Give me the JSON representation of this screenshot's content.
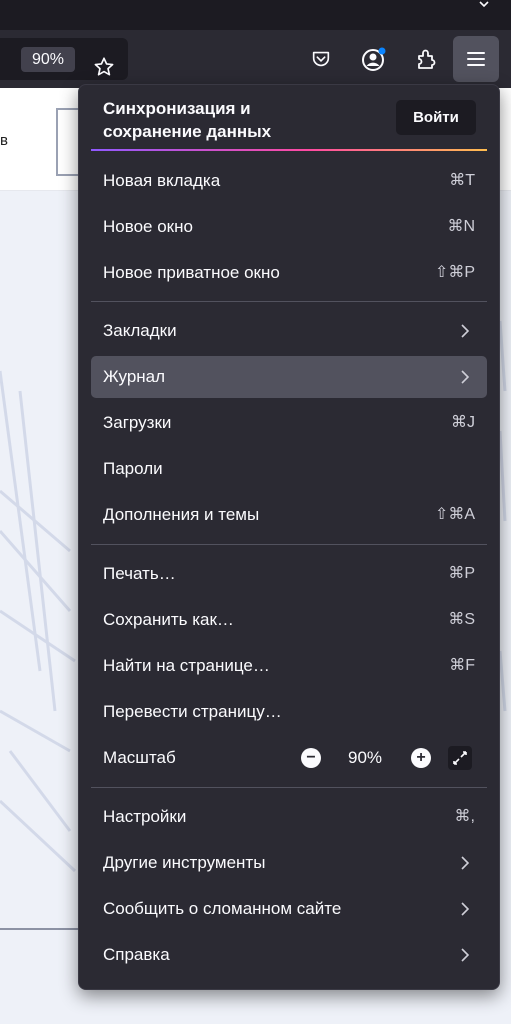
{
  "toolbar": {
    "zoom_badge": "90%",
    "icons": [
      "bookmark-star-icon",
      "pocket-icon",
      "account-icon",
      "extensions-icon",
      "hamburger-menu-icon"
    ]
  },
  "page": {
    "fragment_text": "в"
  },
  "menu": {
    "sync_title": "Синхронизация и сохранение данных",
    "signin_label": "Войти",
    "items": [
      {
        "label": "Новая вкладка",
        "shortcut": "⌘T"
      },
      {
        "label": "Новое окно",
        "shortcut": "⌘N"
      },
      {
        "label": "Новое приватное окно",
        "shortcut": "⇧⌘P"
      },
      {
        "label": "Закладки",
        "submenu": true
      },
      {
        "label": "Журнал",
        "submenu": true,
        "highlighted": true
      },
      {
        "label": "Загрузки",
        "shortcut": "⌘J"
      },
      {
        "label": "Пароли"
      },
      {
        "label": "Дополнения и темы",
        "shortcut": "⇧⌘A"
      },
      {
        "label": "Печать…",
        "shortcut": "⌘P"
      },
      {
        "label": "Сохранить как…",
        "shortcut": "⌘S"
      },
      {
        "label": "Найти на странице…",
        "shortcut": "⌘F"
      },
      {
        "label": "Перевести страницу…"
      },
      {
        "label": "Настройки",
        "shortcut": "⌘,"
      },
      {
        "label": "Другие инструменты",
        "submenu": true
      },
      {
        "label": "Сообщить о сломанном сайте",
        "submenu": true
      },
      {
        "label": "Справка",
        "submenu": true
      }
    ],
    "zoom": {
      "label": "Масштаб",
      "value": "90%",
      "decrease": "−",
      "increase": "+"
    }
  },
  "colors": {
    "menu_bg": "#2b2a33",
    "highlight": "#52525e",
    "sync_gradient": [
      "#9059ff",
      "#ff4aa2",
      "#ffbd4f"
    ]
  }
}
